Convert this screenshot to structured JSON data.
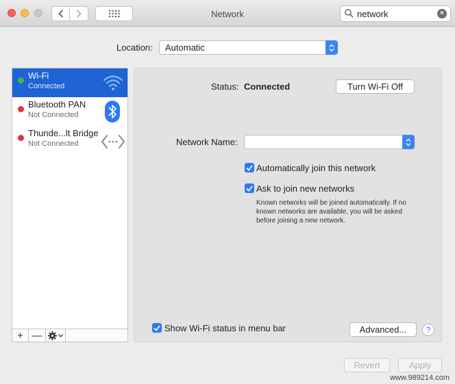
{
  "window": {
    "title": "Network",
    "search": {
      "value": "network"
    }
  },
  "location": {
    "label": "Location:",
    "value": "Automatic"
  },
  "services": [
    {
      "name": "Wi-Fi",
      "status": "Connected",
      "dot_color": "#3cbd43",
      "icon": "wifi-icon",
      "selected": true
    },
    {
      "name": "Bluetooth PAN",
      "status": "Not Connected",
      "dot_color": "#e0353b",
      "icon": "bluetooth-icon",
      "selected": false
    },
    {
      "name": "Thunde...lt Bridge",
      "status": "Not Connected",
      "dot_color": "#e0353b",
      "icon": "thunderbolt-bridge-icon",
      "selected": false
    }
  ],
  "list_footer": {
    "add": "+",
    "remove": "—"
  },
  "detail": {
    "status_label": "Status:",
    "status_value": "Connected",
    "turn_off_button": "Turn Wi-Fi Off",
    "network_name_label": "Network Name:",
    "network_name_value": "",
    "auto_join_label": "Automatically join this network",
    "ask_join_label": "Ask to join new networks",
    "ask_join_help": "Known networks will be joined automatically. If no known networks are available, you will be asked before joining a new network.",
    "show_status_label": "Show Wi-Fi status in menu bar",
    "advanced_button": "Advanced...",
    "help_glyph": "?"
  },
  "footer": {
    "revert_button": "Revert",
    "apply_button": "Apply"
  },
  "watermark": "www.989214.com",
  "colors": {
    "accent": "#2f79f2",
    "selection": "#1f63d4",
    "connected": "#3cbd43",
    "disconnected": "#e0353b"
  }
}
